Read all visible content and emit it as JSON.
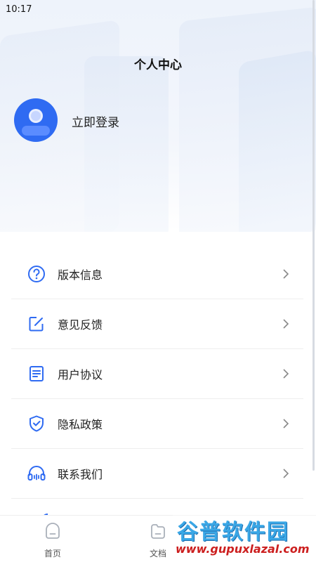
{
  "status_bar": {
    "time": "10:17"
  },
  "header": {
    "title": "个人中心"
  },
  "profile": {
    "login_label": "立即登录"
  },
  "menu": [
    {
      "label": "版本信息",
      "icon": "question-circle-icon"
    },
    {
      "label": "意见反馈",
      "icon": "edit-square-icon"
    },
    {
      "label": "用户协议",
      "icon": "document-icon"
    },
    {
      "label": "隐私政策",
      "icon": "shield-check-icon"
    },
    {
      "label": "联系我们",
      "icon": "headset-icon"
    }
  ],
  "bottom_nav": [
    {
      "label": "首页",
      "icon": "home-icon"
    },
    {
      "label": "文档",
      "icon": "folder-icon"
    }
  ],
  "watermark": {
    "brand": "谷普软件园",
    "url": "www.gupuxlazal.com"
  },
  "colors": {
    "accent": "#2f6bf2",
    "watermark_blue": "#3aa7e6",
    "watermark_red": "#cc1f1f"
  }
}
